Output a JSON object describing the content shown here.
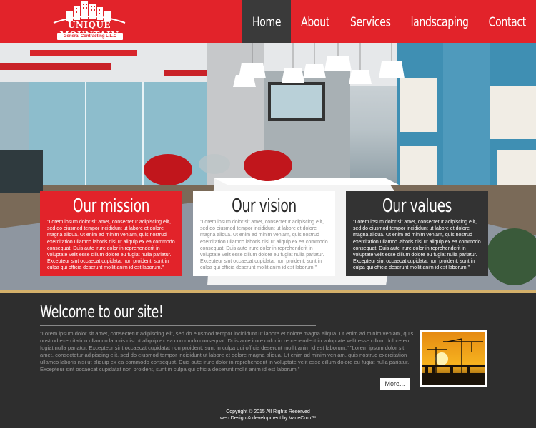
{
  "logo": {
    "name": "UNIQUE MOUNTAIN",
    "subtitle": "General Contracting L.L.C"
  },
  "nav": {
    "items": [
      {
        "label": "Home",
        "active": true
      },
      {
        "label": "About us",
        "active": false
      },
      {
        "label": "Services",
        "active": false
      },
      {
        "label": "landscaping",
        "active": false
      },
      {
        "label": "Contact us",
        "active": false
      }
    ]
  },
  "boxes": {
    "mission": {
      "title": "Our mission",
      "text": "\"Lorem ipsum dolor sit amet, consectetur adipiscing elit, sed do eiusmod tempor incididunt ut labore et dolore magna aliqua. Ut enim ad minim veniam, quis nostrud exercitation ullamco laboris nisi ut aliquip ex ea commodo consequat. Duis aute irure dolor in reprehenderit in voluptate velit esse cillum dolore eu fugiat nulla pariatur. Excepteur sint occaecat cupidatat non proident, sunt in culpa qui officia deserunt mollit anim id est laborum.\""
    },
    "vision": {
      "title": "Our vision",
      "text": "\"Lorem ipsum dolor sit amet, consectetur adipiscing elit, sed do eiusmod tempor incididunt ut labore et dolore magna aliqua. Ut enim ad minim veniam, quis nostrud exercitation ullamco laboris nisi ut aliquip ex ea commodo consequat. Duis aute irure dolor in reprehenderit in voluptate velit esse cillum dolore eu fugiat nulla pariatur. Excepteur sint occaecat cupidatat non proident, sunt in culpa qui officia deserunt mollit anim id est laborum.\""
    },
    "values": {
      "title": "Our values",
      "text": "\"Lorem ipsum dolor sit amet, consectetur adipiscing elit, sed do eiusmod tempor incididunt ut labore et dolore magna aliqua. Ut enim ad minim veniam, quis nostrud exercitation ullamco laboris nisi ut aliquip ex ea commodo consequat. Duis aute irure dolor in reprehenderit in voluptate velit esse cillum dolore eu fugiat nulla pariatur. Excepteur sint occaecat cupidatat non proident, sunt in culpa qui officia deserunt mollit anim id est laborum.\""
    }
  },
  "welcome": {
    "title": "Welcome to our site!",
    "text": "\"Lorem ipsum dolor sit amet, consectetur adipiscing elit, sed do eiusmod tempor incididunt ut labore et dolore magna aliqua. Ut enim ad minim veniam, quis nostrud exercitation ullamco laboris nisi ut aliquip ex ea commodo consequat. Duis aute irure dolor in reprehenderit in voluptate velit esse cillum dolore eu fugiat nulla pariatur. Excepteur sint occaecat cupidatat non proident, sunt in culpa qui officia deserunt mollit anim id est laborum.\" \"Lorem ipsum dolor sit amet, consectetur adipiscing elit, sed do eiusmod tempor incididunt ut labore et dolore magna aliqua. Ut enim ad minim veniam, quis nostrud exercitation ullamco laboris nisi ut aliquip ex ea commodo consequat. Duis aute irure dolor in reprehenderit in voluptate velit esse cillum dolore eu fugiat nulla pariatur. Excepteur sint occaecat cupidatat non proident, sunt in culpa qui officia deserunt mollit anim id est laborum.\"",
    "more_label": "More..."
  },
  "footer": {
    "copyright": "Copyright © 2015 All Rights Reserved",
    "credit": "web Design & development by VadeCom™"
  },
  "colors": {
    "brand_red": "#e2232a",
    "dark": "#2e2e2e",
    "gold": "#d4b06a"
  }
}
